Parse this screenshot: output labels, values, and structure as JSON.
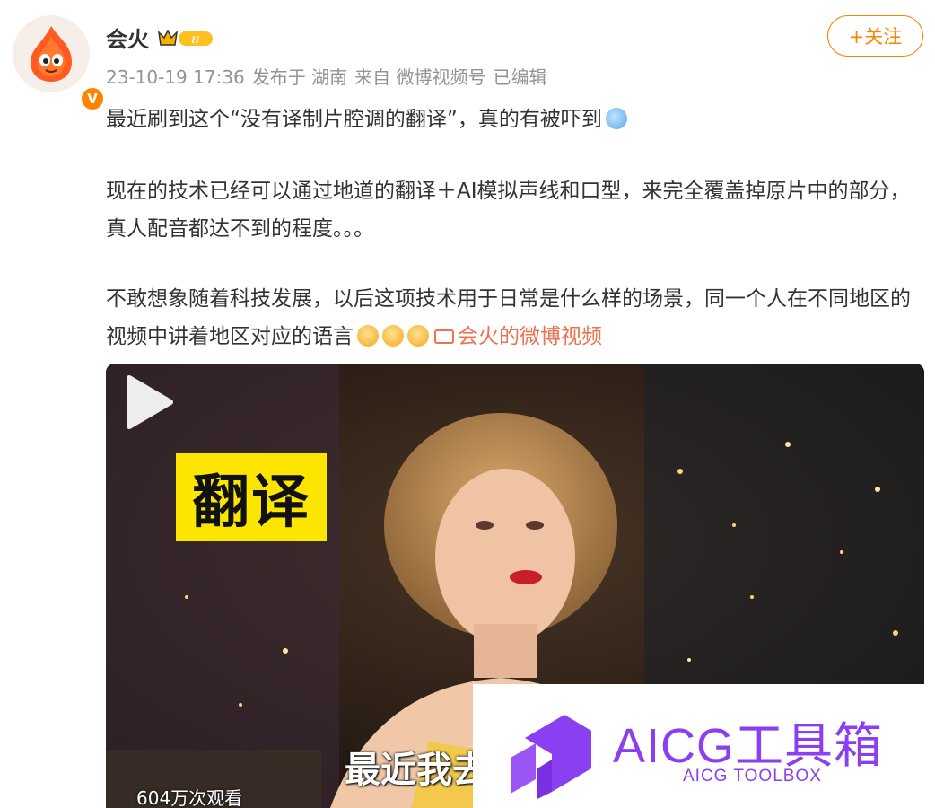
{
  "post": {
    "username": "会火",
    "verified_badge": "V",
    "date": "23-10-19 17:36",
    "publish_location": "发布于 湖南",
    "source": "来自 微博视频号",
    "edited": "已编辑",
    "follow_label": "+关注",
    "para1": "最近刷到这个“没有译制片腔调的翻译”，真的有被吓到",
    "para2": "现在的技术已经可以通过地道的翻译＋AI模拟声线和口型，来完全覆盖掉原片中的部分，真人配音都达不到的程度。。。",
    "para3": "不敢想象随着科技发展，以后这项技术用于日常是什么样的场景，同一个人在不同地区的视频中讲着地区对应的语言",
    "video_link": "会火的微博视频"
  },
  "video": {
    "overlay_label": "翻译",
    "subtitle": "最近我去",
    "views": "604万次观看"
  },
  "watermark": {
    "title": "AICG工具箱",
    "subtitle": "AICG TOOLBOX"
  },
  "icons": {
    "avatar": "flame-mascot-icon",
    "crown": "crown-level-icon",
    "emoji1": "sweat-emoji-icon",
    "emoji2": "shocked-emoji-icon",
    "camera": "video-camera-icon",
    "play": "play-icon"
  },
  "colors": {
    "accent": "#ff8200",
    "link": "#eb7350",
    "watermark": "#8a3ff0",
    "label_bg": "#fce600"
  }
}
